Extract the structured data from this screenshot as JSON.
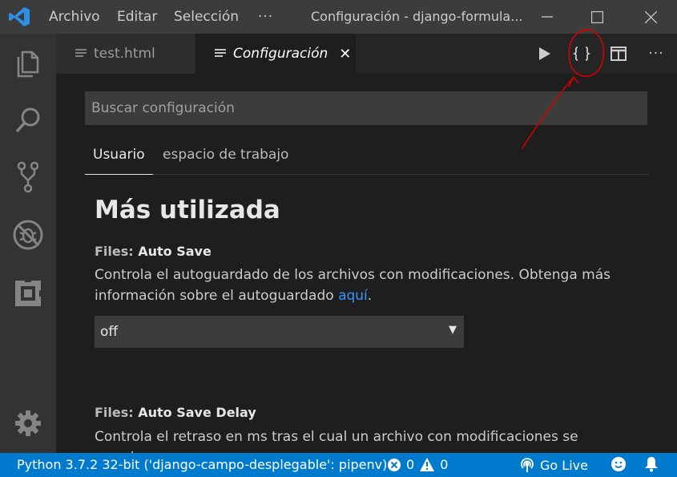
{
  "titlebar": {
    "menu": [
      "Archivo",
      "Editar",
      "Selección",
      "···"
    ],
    "window_title": "Configuración - django-formula..."
  },
  "activity_bar": {
    "icons": [
      "files-icon",
      "search-icon",
      "source-control-icon",
      "debug-icon",
      "extensions-icon",
      "settings-gear-icon"
    ]
  },
  "tabs": [
    {
      "label": "test.html",
      "active": false
    },
    {
      "label": "Configuración",
      "active": true,
      "close": "✕"
    }
  ],
  "toolbar": {
    "buttons": [
      "run-icon",
      "open-settings-json-icon",
      "split-editor-icon",
      "more-actions-icon"
    ],
    "more": "···"
  },
  "settings": {
    "search_placeholder": "Buscar configuración",
    "scopes": [
      "Usuario",
      "espacio de trabajo"
    ],
    "section_title": "Más utilizada",
    "items": [
      {
        "category": "Files: ",
        "key": "Auto Save",
        "description_line1": "Controla el autoguardado de los archivos con modificaciones. Obtenga más",
        "description_line2": "información sobre el autoguardado ",
        "link": "aquí",
        "after_link": ".",
        "value": "off"
      },
      {
        "category": "Files: ",
        "key": "Auto Save Delay",
        "description_line1": "Controla el retraso en ms tras el cual un archivo con modificaciones se guarda"
      }
    ]
  },
  "statusbar": {
    "interpreter": "Python 3.7.2 32-bit ('django-campo-desplegable': pipenv)",
    "errors": "0",
    "warnings": "0",
    "go_live": "Go Live"
  },
  "colors": {
    "accent": "#007acc",
    "link": "#3794ff",
    "annotation": "#d10000"
  }
}
